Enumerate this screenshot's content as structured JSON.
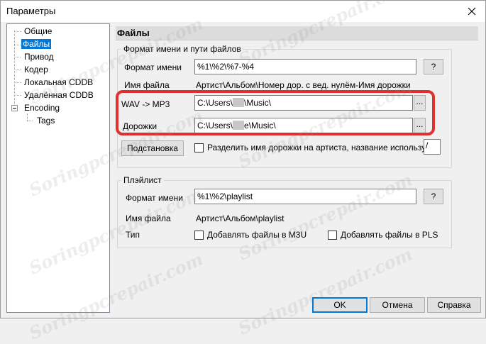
{
  "window": {
    "title": "Параметры"
  },
  "tree": {
    "items": [
      {
        "label": "Общие",
        "selected": false
      },
      {
        "label": "Файлы",
        "selected": true
      },
      {
        "label": "Привод",
        "selected": false
      },
      {
        "label": "Кодер",
        "selected": false
      },
      {
        "label": "Локальная CDDB",
        "selected": false
      },
      {
        "label": "Удалённая CDDB",
        "selected": false
      },
      {
        "label": "Encoding",
        "selected": false,
        "expanded": true
      },
      {
        "label": "Tags",
        "selected": false,
        "child": true
      }
    ]
  },
  "section": {
    "title": "Файлы"
  },
  "files_group": {
    "title": "Формат имени и пути файлов",
    "name_format_label": "Формат имени",
    "name_format_value": "%1\\%2\\%7-%4",
    "name_format_help": "?",
    "filename_label": "Имя файла",
    "filename_value": "Артист\\Альбом\\Номер дор. с вед. нулём-Имя дорожки",
    "wav_mp3_label": "WAV -> MP3",
    "wav_mp3_prefix": "C:\\Users\\",
    "wav_mp3_suffix": "\\Music\\",
    "tracks_label": "Дорожки",
    "tracks_prefix": "C:\\Users\\",
    "tracks_suffix": "e\\Music\\",
    "browse_label": "...",
    "substitution_button": "Подстановка",
    "split_checkbox_label": "Разделить имя дорожки на артиста, название используя:",
    "split_value": "/"
  },
  "playlist_group": {
    "title": "Плэйлист",
    "name_format_label": "Формат имени",
    "name_format_value": "%1\\%2\\playlist",
    "help": "?",
    "filename_label": "Имя файла",
    "filename_value": "Артист\\Альбом\\playlist",
    "type_label": "Тип",
    "m3u_label": "Добавлять файлы в M3U",
    "pls_label": "Добавлять файлы в PLS"
  },
  "buttons": {
    "ok": "OK",
    "cancel": "Отмена",
    "help": "Справка"
  },
  "watermark": "Soringpcrepair.com",
  "colors": {
    "accent": "#0078d7",
    "highlight": "#e0302d"
  }
}
